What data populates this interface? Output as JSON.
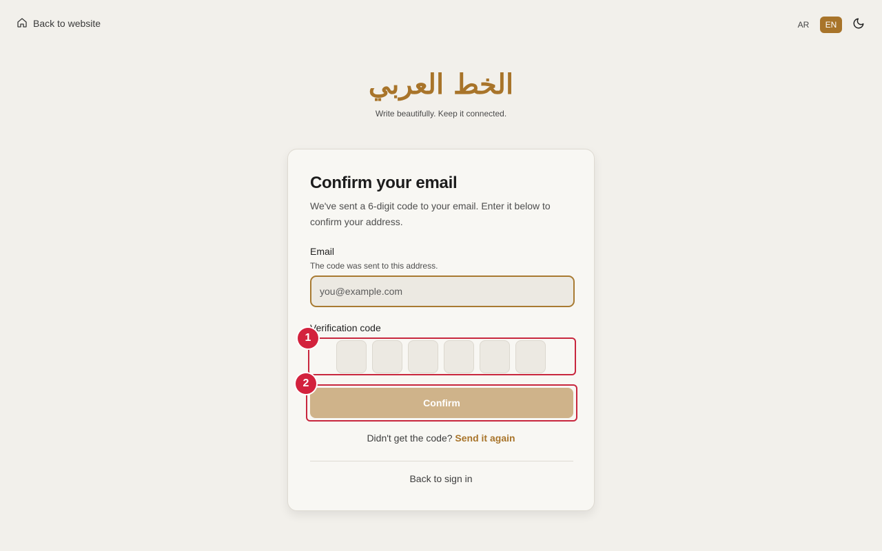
{
  "topbar": {
    "back_label": "Back to website",
    "back_icon": "home-icon",
    "lang_ar": "AR",
    "lang_en": "EN",
    "active_lang": "EN",
    "theme_icon": "moon-icon"
  },
  "brand": {
    "logo_text": "الخط العربي",
    "tagline": "Write beautifully. Keep it connected."
  },
  "card": {
    "title": "Confirm your email",
    "description": "We've sent a 6-digit code to your email. Enter it below to confirm your address.",
    "email": {
      "label": "Email",
      "hint": "The code was sent to this address.",
      "placeholder": "you@example.com",
      "value": ""
    },
    "code": {
      "label": "Verification code",
      "digits": [
        "",
        "",
        "",
        "",
        "",
        ""
      ]
    },
    "confirm_label": "Confirm",
    "resend_prompt": "Didn't get the code?",
    "resend_link": "Send it again",
    "back_to_signin": "Back to sign in"
  },
  "annotations": {
    "marker_1": "1",
    "marker_2": "2"
  },
  "colors": {
    "accent": "#a8742a",
    "accent_dark": "#a87a31",
    "confirm_disabled": "#cfb38a",
    "annotation_red": "#c8263d",
    "background": "#f2f0eb",
    "card": "#f8f7f3"
  }
}
